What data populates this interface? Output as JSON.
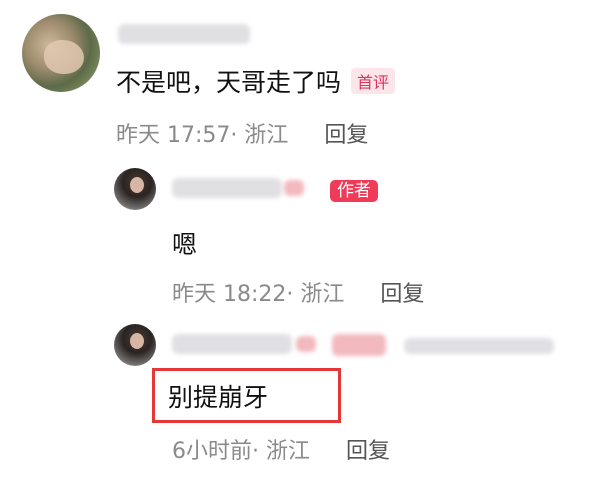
{
  "top_comment": {
    "text": "不是吧，天哥走了吗",
    "tag": "首评",
    "time": "昨天 17:57",
    "location": "· 浙江",
    "reply_label": "回复"
  },
  "replies": [
    {
      "tag": "作者",
      "text": "嗯",
      "time": "昨天 18:22",
      "location": "· 浙江",
      "reply_label": "回复"
    },
    {
      "text": "别提崩牙",
      "time": "6小时前",
      "location": "· 浙江",
      "reply_label": "回复"
    }
  ],
  "colors": {
    "highlight_box": "#e43737",
    "author_tag": "#f03b58",
    "first_tag": "#e0345a"
  }
}
